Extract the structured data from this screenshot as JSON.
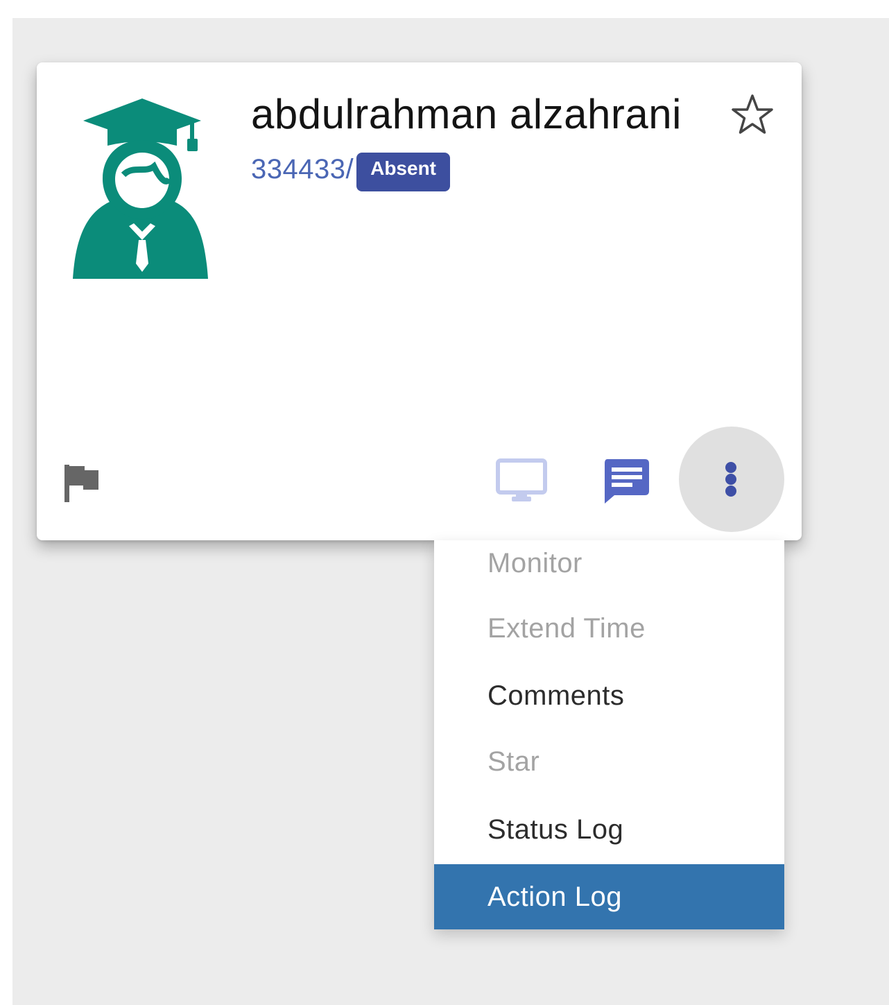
{
  "student": {
    "name": "abdulrahman alzahrani",
    "id": "334433/",
    "status": "Absent"
  },
  "icons": {
    "avatar": "graduate-student-icon",
    "star": "star-outline-icon",
    "flag": "flag-icon",
    "monitor": "monitor-icon",
    "comments": "comment-icon",
    "more": "more-vertical-icon"
  },
  "menu": {
    "items": [
      {
        "label": "Monitor",
        "state": "disabled"
      },
      {
        "label": "Extend Time",
        "state": "disabled"
      },
      {
        "label": "Comments",
        "state": "enabled"
      },
      {
        "label": "Star",
        "state": "disabled"
      },
      {
        "label": "Status Log",
        "state": "enabled"
      },
      {
        "label": "Action Log",
        "state": "active"
      }
    ]
  },
  "colors": {
    "background": "#ececec",
    "avatar": "#0b8c7a",
    "accent": "#3e4fa6",
    "id_text": "#4a66b4",
    "badge": "#3d4f9f",
    "menu_active": "#3374ae",
    "disabled_text": "#a3a3a3",
    "monitor_icon": "#c3cbee"
  }
}
